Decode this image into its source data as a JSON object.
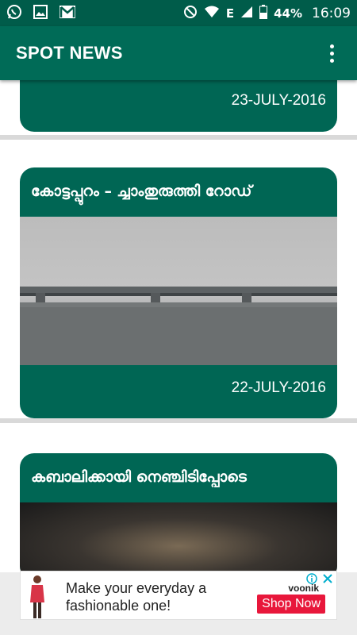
{
  "status_bar": {
    "battery": "44%",
    "network": "E",
    "time": "16:09",
    "icons": [
      "whatsapp-icon",
      "image-icon",
      "gmail-icon",
      "block-icon",
      "wifi-icon",
      "signal-icon",
      "battery-icon"
    ]
  },
  "app_bar": {
    "title": "SPOT NEWS",
    "menu_icon": "overflow-menu-icon"
  },
  "feed": {
    "items": [
      {
        "title": "",
        "date": "23-JULY-2016"
      },
      {
        "title": "കോട്ടപ്പുറം – ച്ചാംതുരുത്തി റോഡ്",
        "date": "22-JULY-2016"
      },
      {
        "title": "കബാലിക്കായി നെഞ്ചിടിപ്പോടെ",
        "date": ""
      }
    ]
  },
  "ad": {
    "text_line1": "Make your everyday a",
    "text_line2": "fashionable one!",
    "cta": "Shop Now",
    "brand": "voonik",
    "icons": [
      "adchoices-icon",
      "close-icon"
    ]
  },
  "colors": {
    "status_bar": "#005c4a",
    "app_bar": "#006b57",
    "card": "#006654",
    "cta": "#e8173b"
  }
}
